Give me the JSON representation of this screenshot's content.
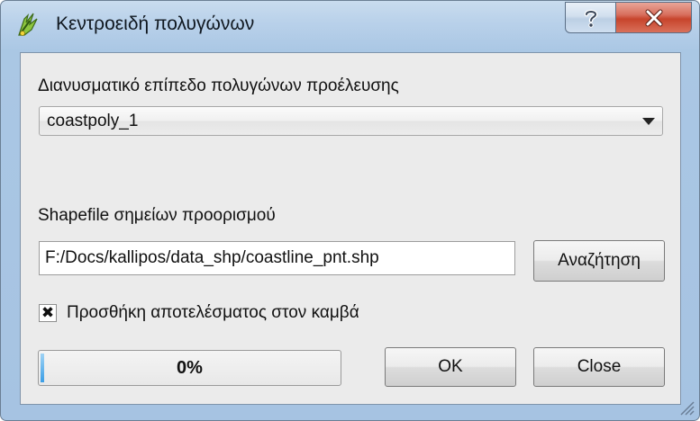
{
  "window": {
    "title": "Κεντροειδή πολυγώνων",
    "help_label": "?",
    "close_label": "X"
  },
  "form": {
    "source_label": "Διανυσματικό επίπεδο πολυγώνων προέλευσης",
    "source_value": "coastpoly_1",
    "output_label": "Shapefile σημείων προορισμού",
    "output_value": "F:/Docs/kallipos/data_shp/coastline_pnt.shp",
    "browse_label": "Αναζήτηση",
    "add_to_canvas_label": "Προσθήκη αποτελέσματος στον καμβά",
    "add_to_canvas_checked": true,
    "checkbox_mark": "✖",
    "progress_text": "0%",
    "progress_value": 0,
    "ok_label": "OK",
    "close_label": "Close"
  },
  "colors": {
    "close_button": "#c7442c",
    "progress_fill": "#3a9ee6"
  },
  "icons": {
    "app": "qgis-icon",
    "combo_arrow": "chevron-down-icon",
    "grip": "resize-grip-icon"
  }
}
